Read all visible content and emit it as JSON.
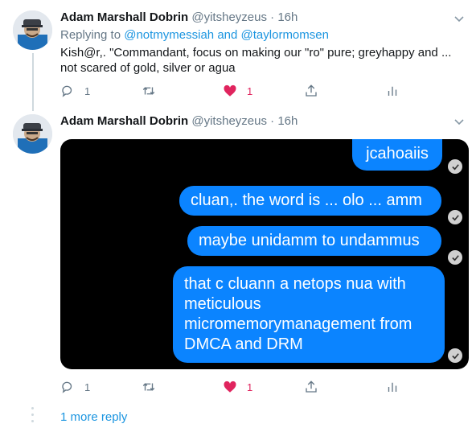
{
  "tweets": [
    {
      "author_name": "Adam Marshall Dobrin",
      "handle": "@yitsheyzeus",
      "separator": "·",
      "time": "16h",
      "reply_prefix": "Replying to",
      "reply_mention_1": "@notmymessiah",
      "reply_and": "and",
      "reply_mention_2": "@taylormomsen",
      "text": "Kish@r,. \"Commandant, focus on making our \"ro\" pure; greyhappy and ... not scared of gold, silver or agua",
      "reply_count": "1",
      "retweet_count": "",
      "like_count": "1",
      "liked": true
    },
    {
      "author_name": "Adam Marshall Dobrin",
      "handle": "@yitsheyzeus",
      "separator": "·",
      "time": "16h",
      "reply_count": "1",
      "retweet_count": "",
      "like_count": "1",
      "liked": true,
      "media_messages": [
        "jcahoaiis",
        "cluan,. the word is ... olo ... amm",
        "maybe unidamm to undammus",
        "that c cluann a netops nua with meticulous micromemorymanagement from DMCA and DRM"
      ]
    }
  ],
  "more_replies_label": "1 more reply",
  "colors": {
    "link": "#1b95e0",
    "like": "#e0245e",
    "bubble": "#0b84ff",
    "muted": "#657786"
  },
  "icons": [
    "reply-icon",
    "retweet-icon",
    "heart-icon",
    "share-icon",
    "analytics-icon",
    "chevron-down-icon",
    "read-check-icon"
  ]
}
